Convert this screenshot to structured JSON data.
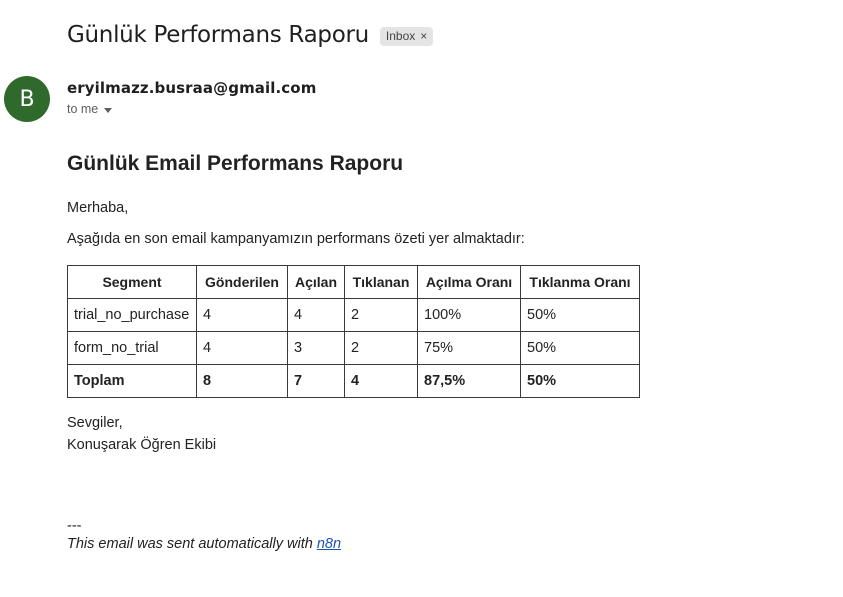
{
  "email": {
    "subject": "Günlük Performans Raporu",
    "label": "Inbox",
    "label_remove": "×",
    "avatar_initial": "B",
    "avatar_color": "#2f6a2c",
    "sender": "eryilmazz.busraa@gmail.com",
    "recipient": "to me"
  },
  "body": {
    "title": "Günlük Email Performans Raporu",
    "greeting": "Merhaba,",
    "intro": "Aşağıda en son email kampanyamızın performans özeti yer almaktadır:",
    "table": {
      "headers": [
        "Segment",
        "Gönderilen",
        "Açılan",
        "Tıklanan",
        "Açılma Oranı",
        "Tıklanma Oranı"
      ],
      "rows": [
        [
          "trial_no_purchase",
          "4",
          "4",
          "2",
          "100%",
          "50%"
        ],
        [
          "form_no_trial",
          "4",
          "3",
          "2",
          "75%",
          "50%"
        ]
      ],
      "total": [
        "Toplam",
        "8",
        "7",
        "4",
        "87,5%",
        "50%"
      ]
    },
    "closing_line1": "Sevgiler,",
    "closing_line2": "Konuşarak Öğren Ekibi",
    "separator": "---",
    "footer_text": "This email was sent automatically with ",
    "footer_link": "n8n"
  }
}
